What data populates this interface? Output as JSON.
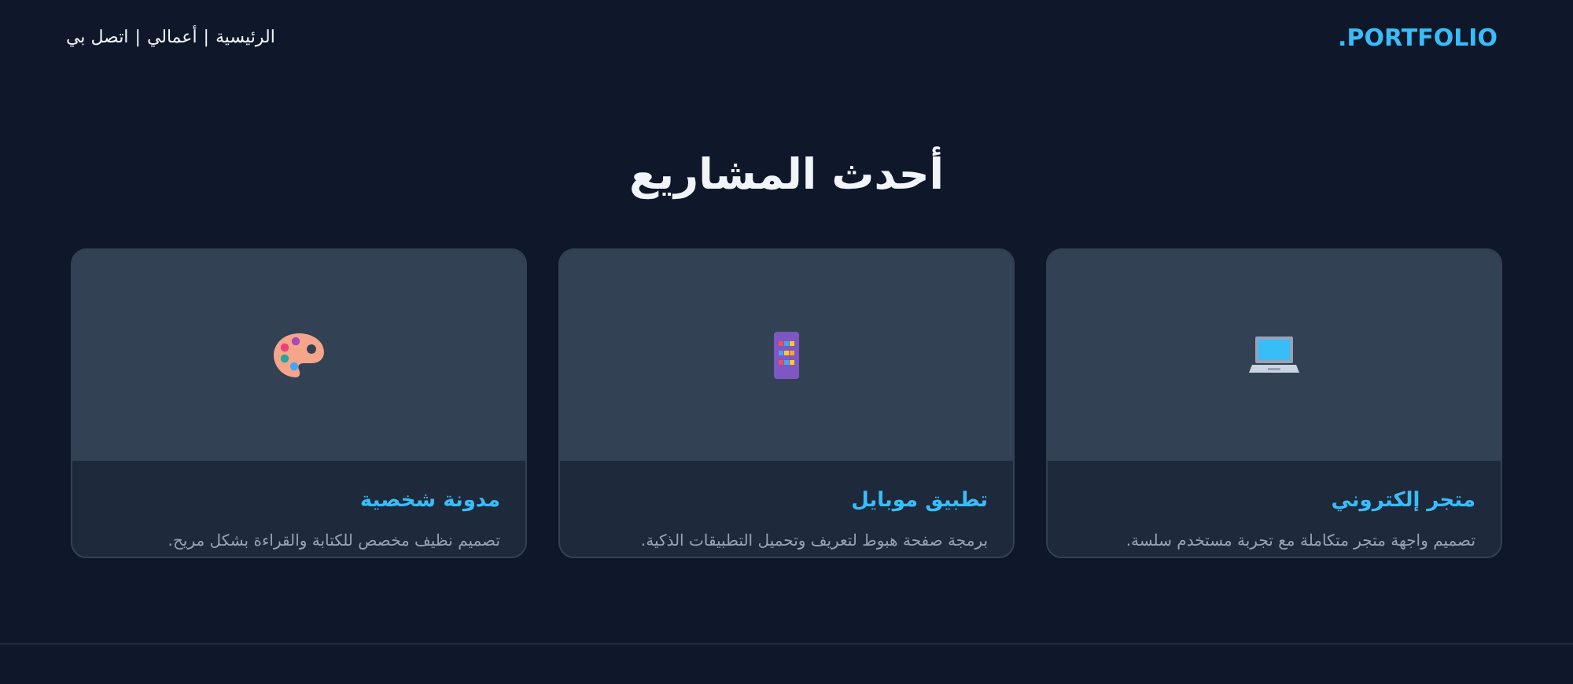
{
  "header": {
    "logo": "PORTFOLIO.",
    "nav": [
      "الرئيسية",
      "أعمالي",
      "اتصل بي"
    ],
    "separator": "|"
  },
  "section": {
    "title": "أحدث المشاريع"
  },
  "projects": [
    {
      "title": "متجر إلكتروني",
      "description": "تصميم واجهة متجر متكاملة مع تجربة مستخدم سلسة."
    },
    {
      "title": "تطبيق موبايل",
      "description": "برمجة صفحة هبوط لتعريف وتحميل التطبيقات الذكية."
    },
    {
      "title": "مدونة شخصية",
      "description": "تصميم نظيف مخصص للكتابة والقراءة بشكل مريح."
    }
  ]
}
